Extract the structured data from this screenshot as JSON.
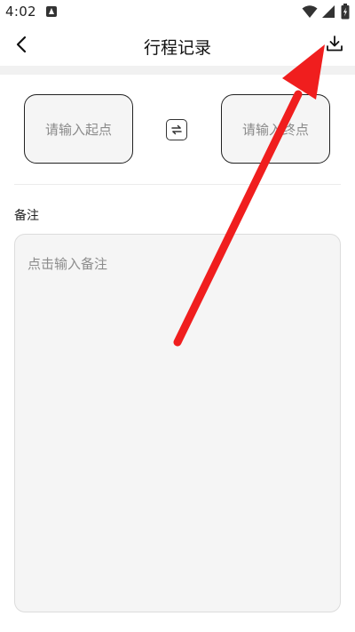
{
  "status_bar": {
    "time": "4:02",
    "icons": [
      "app-notification-icon",
      "wifi-icon",
      "signal-icon",
      "battery-icon"
    ]
  },
  "header": {
    "title": "行程记录",
    "back_icon": "chevron-left-icon",
    "download_icon": "download-icon"
  },
  "trip": {
    "start_placeholder": "请输入起点",
    "end_placeholder": "请输入终点",
    "swap_icon": "swap-arrows-icon"
  },
  "remark": {
    "label": "备注",
    "placeholder": "点击输入备注"
  },
  "annotation": {
    "arrow_color": "#f01e1e"
  }
}
